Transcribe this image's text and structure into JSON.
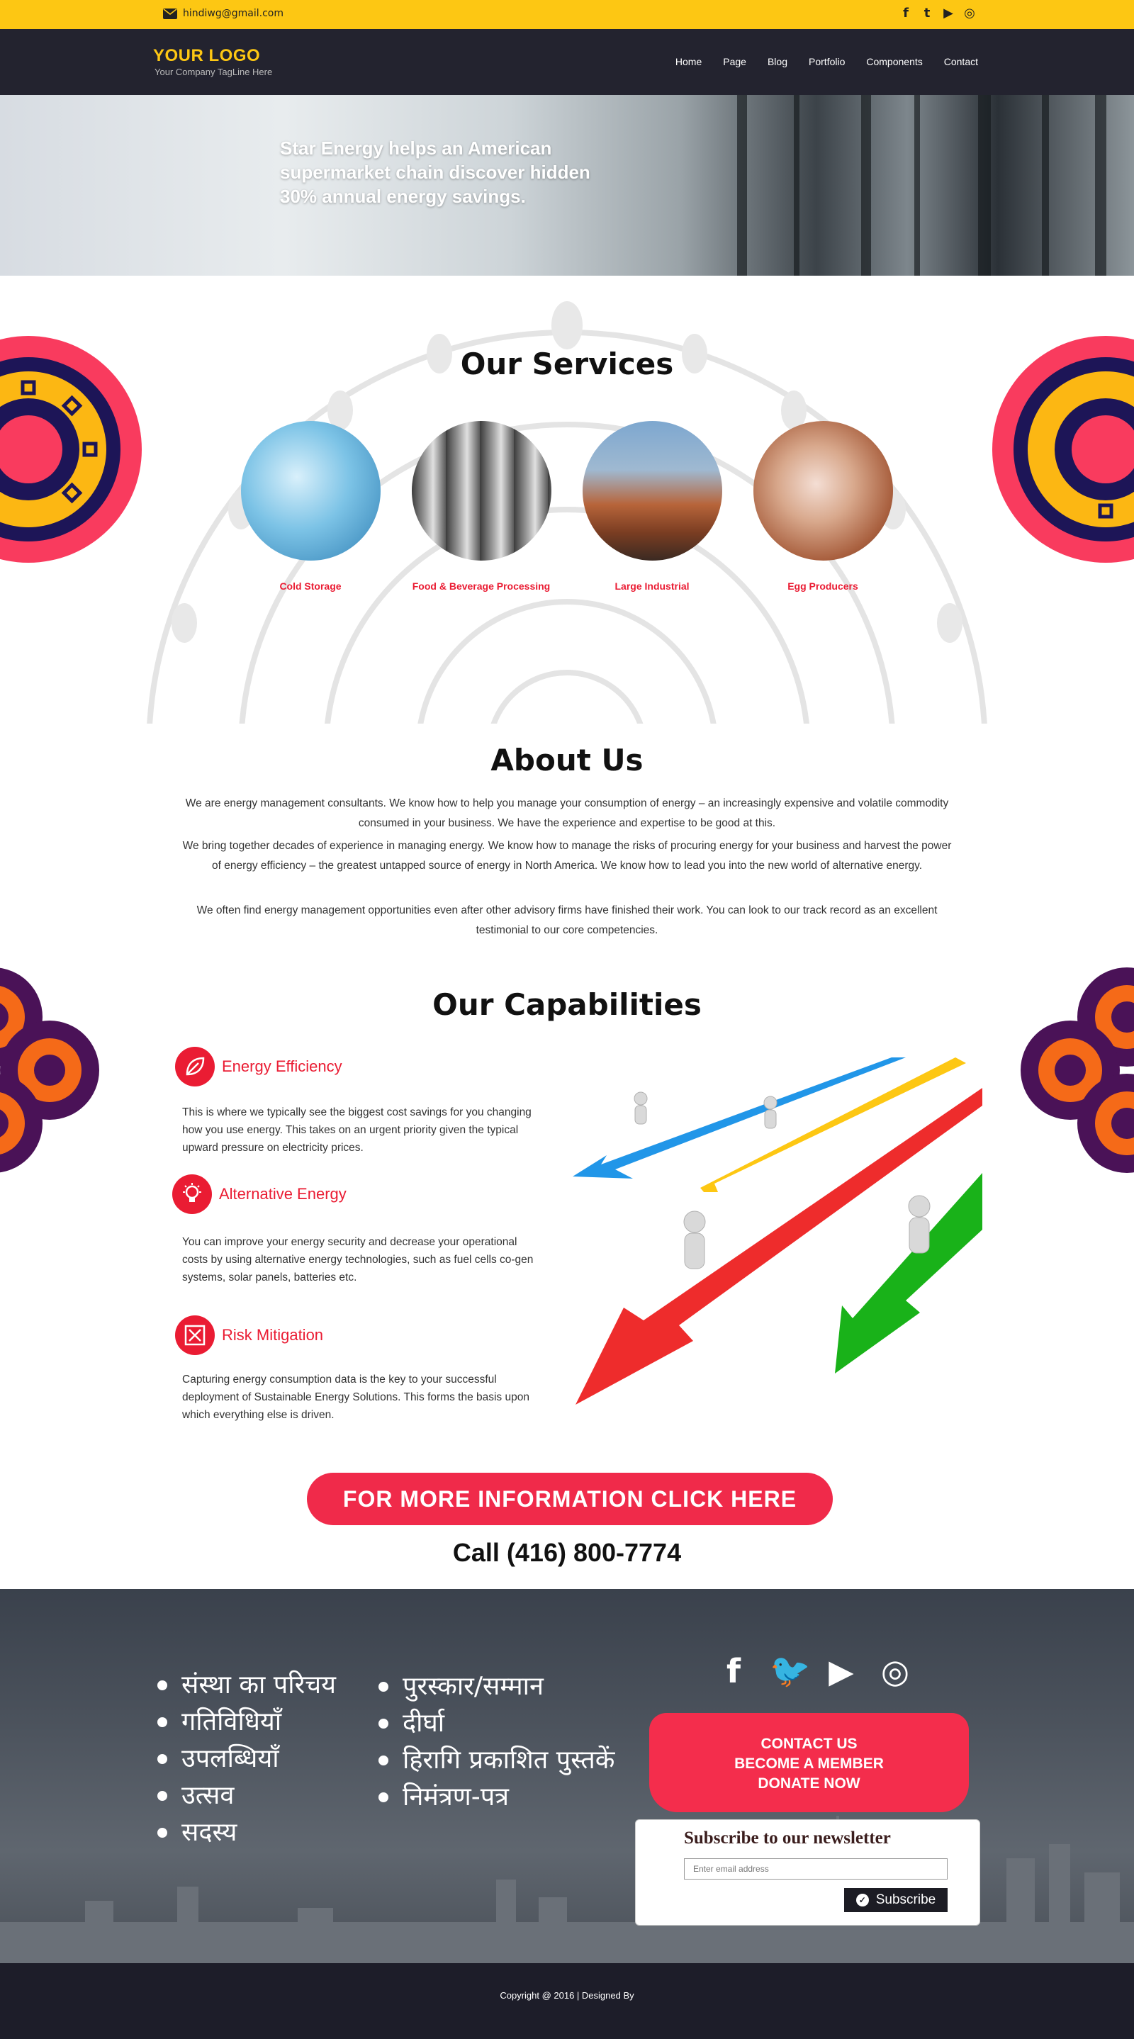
{
  "topbar": {
    "email": "hindiwg@gmail.com",
    "socials": [
      {
        "icon": "facebook-icon",
        "glyph": "f"
      },
      {
        "icon": "twitter-icon",
        "glyph": "t"
      },
      {
        "icon": "youtube-icon",
        "glyph": "▶"
      },
      {
        "icon": "instagram-icon",
        "glyph": "◎"
      }
    ]
  },
  "header": {
    "logo": "YOUR LOGO",
    "tagline": "Your Company TagLine Here",
    "menu": [
      "Home",
      "Page",
      "Blog",
      "Portfolio",
      "Components",
      "Contact"
    ]
  },
  "hero": {
    "headline": "Star Energy helps an American supermarket chain discover hidden 30% annual energy savings."
  },
  "services": {
    "title": "Our Services",
    "items": [
      {
        "label": "Cold Storage",
        "image": "ice-cubes-photo"
      },
      {
        "label": "Food & Beverage Processing",
        "image": "steel-tanks-photo"
      },
      {
        "label": "Large Industrial",
        "image": "industrial-plant-photo"
      },
      {
        "label": "Egg Producers",
        "image": "eggs-photo"
      }
    ]
  },
  "about": {
    "title": "About Us",
    "paragraphs": [
      "We are energy management consultants. We know how to help you manage your consumption of energy – an increasingly expensive and volatile commodity consumed in your business. We have the experience and expertise to be good at this.",
      "We bring together decades of experience in managing energy. We know how to manage the risks of procuring energy for your business and harvest the power of energy efficiency – the greatest untapped source of energy in North America. We know how to lead you into the new world of alternative energy.",
      "We often find energy management opportunities even after other advisory firms have finished their work. You can look to our track record as an excellent testimonial to our core competencies."
    ]
  },
  "capabilities": {
    "title": "Our Capabilities",
    "items": [
      {
        "title": "Energy Efficiency",
        "icon": "leaf-icon",
        "body": "This is where we typically see the biggest cost savings for you changing how you use energy. This takes on an urgent priority given the typical upward pressure on electricity prices."
      },
      {
        "title": "Alternative Energy",
        "icon": "lightbulb-icon",
        "body": "You can improve your energy security and decrease your operational costs by using alternative energy technologies, such as fuel cells co-gen systems, solar panels, batteries etc."
      },
      {
        "title": "Risk Mitigation",
        "icon": "crossed-box-icon",
        "body": "Capturing energy consumption data is the key to your successful deployment of Sustainable Energy Solutions.  This forms the basis upon which everything else is driven."
      }
    ]
  },
  "cta": {
    "button": "FOR MORE INFORMATION CLICK HERE",
    "phone": "Call (416) 800-7774"
  },
  "footer": {
    "links_left": [
      "संस्था का परिचय",
      "गतिविधियाँ",
      "उपलब्धियाँ",
      "उत्सव",
      "सदस्य"
    ],
    "links_right": [
      "पुरस्कार/सम्मान",
      "दीर्घा",
      "हिरागि प्रकाशित पुस्तकें",
      "निमंत्रण-पत्र"
    ],
    "socials": [
      {
        "icon": "facebook-icon",
        "glyph": "f"
      },
      {
        "icon": "twitter-icon",
        "glyph": "🐦"
      },
      {
        "icon": "youtube-icon",
        "glyph": "▶"
      },
      {
        "icon": "instagram-icon",
        "glyph": "◎"
      }
    ],
    "actions": [
      "CONTACT US",
      "BECOME A MEMBER",
      "DONATE NOW"
    ],
    "newsletter": {
      "title": "Subscribe to our newsletter",
      "placeholder": "Enter email address",
      "button": "Subscribe"
    },
    "copyright": "Copyright @ 2016 | Designed By"
  },
  "colors": {
    "accent_yellow": "#fdc713",
    "nav_dark": "#23232f",
    "accent_red": "#ea1c33",
    "cta_red": "#f02a4a"
  }
}
